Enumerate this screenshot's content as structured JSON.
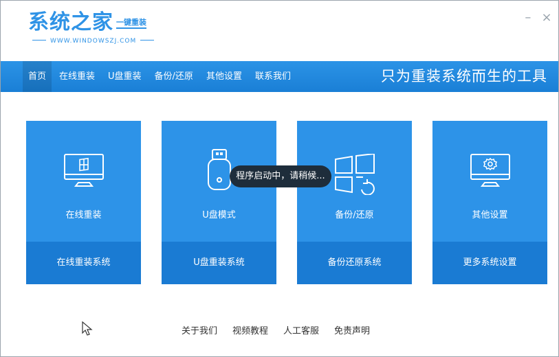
{
  "app": {
    "logo_main": "系统之家",
    "logo_sub": "一键重装",
    "logo_url": "WWW.WINDOWSZJ.COM"
  },
  "window_controls": {
    "minimize_icon": "minimize-icon",
    "close_icon": "close-icon",
    "minimize_label": "–",
    "close_label": "×"
  },
  "nav": {
    "items": [
      {
        "label": "首页",
        "active": true
      },
      {
        "label": "在线重装"
      },
      {
        "label": "U盘重装"
      },
      {
        "label": "备份/还原"
      },
      {
        "label": "其他设置"
      },
      {
        "label": "联系我们"
      }
    ],
    "slogan": "只为重装系统而生的工具"
  },
  "cards": [
    {
      "label": "在线重装",
      "action": "在线重装系统",
      "icon": "monitor-windows-icon"
    },
    {
      "label": "U盘模式",
      "action": "U盘重装系统",
      "icon": "usb-drive-icon"
    },
    {
      "label": "备份/还原",
      "action": "备份还原系统",
      "icon": "windows-restore-icon"
    },
    {
      "label": "其他设置",
      "action": "更多系统设置",
      "icon": "monitor-gear-icon"
    }
  ],
  "toast": {
    "message": "程序启动中，请稍候..."
  },
  "footer": {
    "links": [
      "关于我们",
      "视频教程",
      "人工客服",
      "免责声明"
    ]
  },
  "colors": {
    "brand_blue": "#2d93e8",
    "card_bottom": "#1a7bd3",
    "toast_bg": "#1e2d3b"
  }
}
